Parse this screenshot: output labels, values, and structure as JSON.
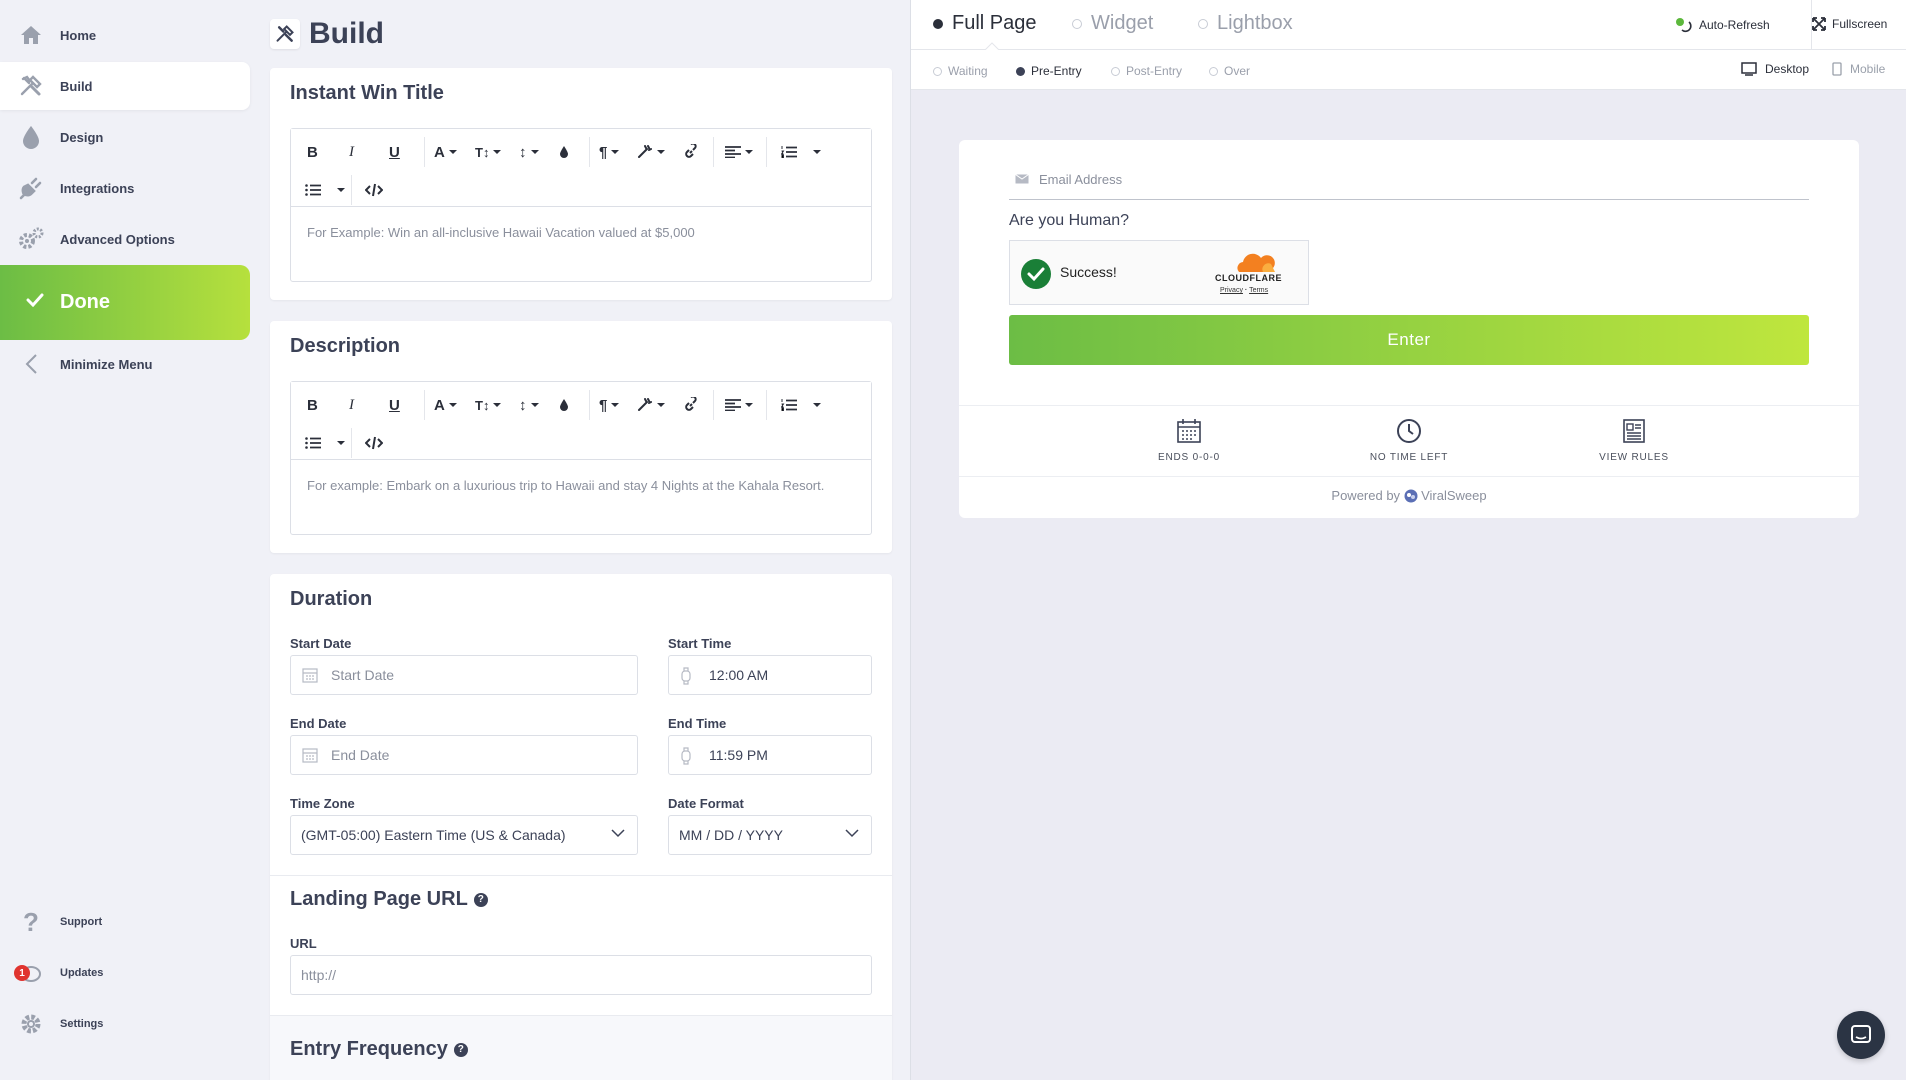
{
  "sidebar": {
    "home": "Home",
    "build": "Build",
    "design": "Design",
    "integrations": "Integrations",
    "advanced": "Advanced Options",
    "done": "Done",
    "minimize": "Minimize Menu",
    "support": "Support",
    "updates": "Updates",
    "updates_badge": "1",
    "settings": "Settings"
  },
  "page": {
    "title": "Build"
  },
  "instant_win": {
    "title": "Instant Win Title",
    "placeholder": "For Example: Win an all-inclusive Hawaii Vacation valued at $5,000"
  },
  "description": {
    "title": "Description",
    "placeholder": "For example: Embark on a luxurious trip to Hawaii and stay 4 Nights at the Kahala Resort."
  },
  "toolbar": {
    "bold": "B",
    "italic": "I",
    "underline": "U",
    "font": "A",
    "size": "T↕",
    "height": "↕",
    "para": "¶"
  },
  "duration": {
    "title": "Duration",
    "start_date_label": "Start Date",
    "start_date_placeholder": "Start Date",
    "start_time_label": "Start Time",
    "start_time_value": "12:00 AM",
    "end_date_label": "End Date",
    "end_date_placeholder": "End Date",
    "end_time_label": "End Time",
    "end_time_value": "11:59 PM",
    "timezone_label": "Time Zone",
    "timezone_value": "(GMT-05:00) Eastern Time (US & Canada)",
    "date_format_label": "Date Format",
    "date_format_value": "MM / DD / YYYY"
  },
  "landing": {
    "title": "Landing Page URL",
    "url_label": "URL",
    "url_placeholder": "http://"
  },
  "entry_frequency": {
    "title": "Entry Frequency"
  },
  "preview": {
    "tabs": [
      "Full Page",
      "Widget",
      "Lightbox"
    ],
    "auto_refresh": "Auto-Refresh",
    "fullscreen": "Fullscreen",
    "states": [
      "Waiting",
      "Pre-Entry",
      "Post-Entry",
      "Over"
    ],
    "desktop": "Desktop",
    "mobile": "Mobile",
    "email_placeholder": "Email Address",
    "human_question": "Are you Human?",
    "captcha_success": "Success!",
    "captcha_logo": "CLOUDFLARE",
    "captcha_privacy": "Privacy",
    "captcha_dot": "·",
    "captcha_terms": "Terms",
    "enter_button": "Enter",
    "stat_ends": "ENDS 0-0-0",
    "stat_time": "NO TIME LEFT",
    "stat_rules": "VIEW RULES",
    "powered_by": "Powered by",
    "brand": "ViralSweep"
  },
  "colors": {
    "accent_green": "#6cbd45",
    "accent_lime": "#b6e03d",
    "text_dark": "#3c4257",
    "badge_red": "#e0342f"
  }
}
